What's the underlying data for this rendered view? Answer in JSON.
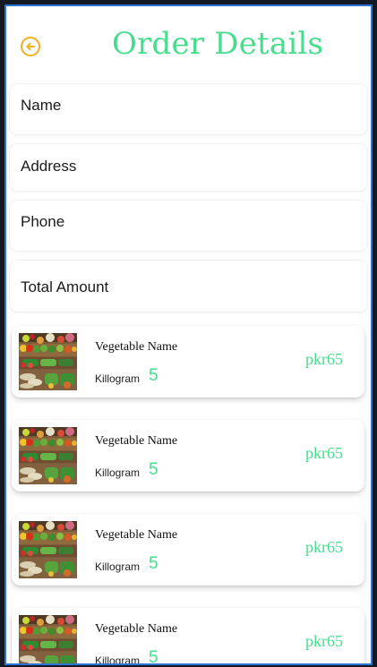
{
  "header": {
    "title": "Order Details",
    "back_icon": "arrow-left-circle-icon",
    "accent_color": "#f0b21c",
    "title_color": "#48dd8d"
  },
  "form": {
    "name_label": "Name",
    "address_label": "Address",
    "phone_label": "Phone",
    "total_amount_label": "Total Amount"
  },
  "items": [
    {
      "name": "Vegetable Name",
      "unit": "Killogram",
      "quantity": "5",
      "price": "pkr65",
      "image": "vegetable-market-photo"
    },
    {
      "name": "Vegetable Name",
      "unit": "Killogram",
      "quantity": "5",
      "price": "pkr65",
      "image": "vegetable-market-photo"
    },
    {
      "name": "Vegetable Name",
      "unit": "Killogram",
      "quantity": "5",
      "price": "pkr65",
      "image": "vegetable-market-photo"
    },
    {
      "name": "Vegetable Name",
      "unit": "Killogram",
      "quantity": "5",
      "price": "pkr65",
      "image": "vegetable-market-photo"
    }
  ]
}
